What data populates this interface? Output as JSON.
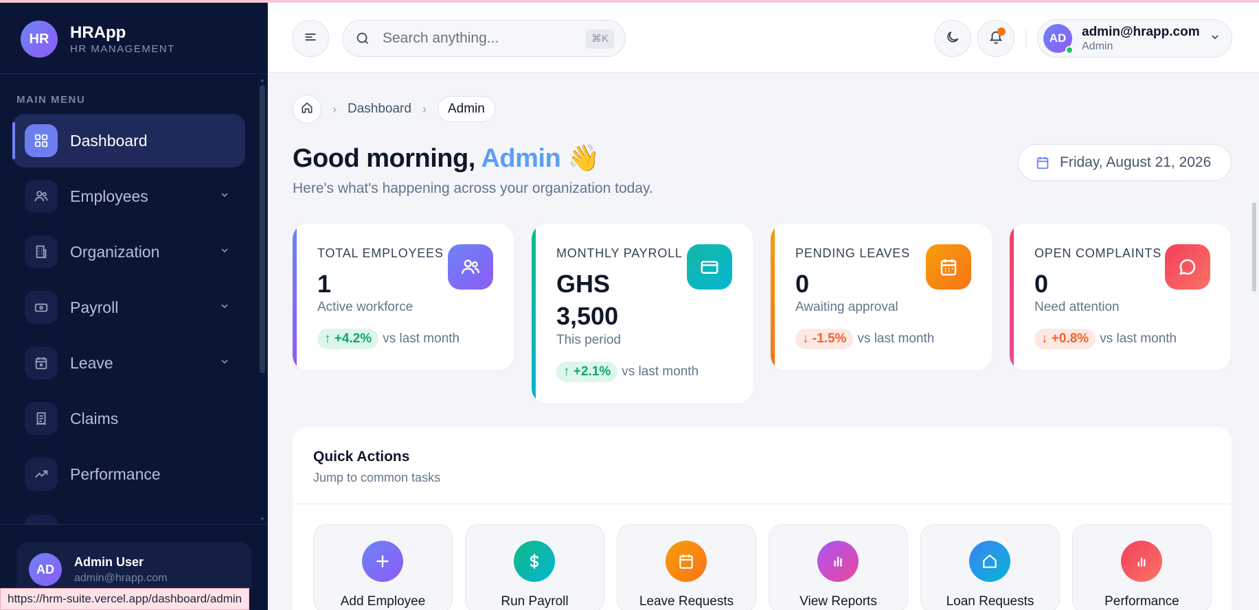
{
  "brand": {
    "logo_initials": "HR",
    "name": "HRApp",
    "subtitle": "HR MANAGEMENT"
  },
  "sidebar": {
    "menu_label": "MAIN MENU",
    "items": [
      {
        "label": "Dashboard",
        "icon": "grid-icon",
        "active": true
      },
      {
        "label": "Employees",
        "icon": "users-icon",
        "has_children": true
      },
      {
        "label": "Organization",
        "icon": "building-icon",
        "has_children": true
      },
      {
        "label": "Payroll",
        "icon": "wallet-icon",
        "has_children": true
      },
      {
        "label": "Leave",
        "icon": "calendar-icon",
        "has_children": true
      },
      {
        "label": "Claims",
        "icon": "receipt-icon"
      },
      {
        "label": "Performance",
        "icon": "trending-up-icon"
      }
    ],
    "user": {
      "initials": "AD",
      "name": "Admin User",
      "email": "admin@hrapp.com"
    }
  },
  "header": {
    "search_placeholder": "Search anything...",
    "shortcut": "⌘K",
    "profile": {
      "initials": "AD",
      "email": "admin@hrapp.com",
      "role": "Admin"
    }
  },
  "breadcrumb": {
    "items": [
      "Dashboard"
    ],
    "current": "Admin"
  },
  "greeting": {
    "prefix": "Good morning, ",
    "name": "Admin",
    "emoji": "👋",
    "subtitle": "Here's what's happening across your organization today."
  },
  "date": "Friday, August 21, 2026",
  "stats": [
    {
      "label": "TOTAL EMPLOYEES",
      "value": "1",
      "caption": "Active workforce",
      "trend": "+4.2%",
      "direction": "up",
      "note": "vs last month",
      "color": "#7c6cf0"
    },
    {
      "label": "MONTHLY PAYROLL",
      "value": "GHS 3,500",
      "caption": "This period",
      "trend": "+2.1%",
      "direction": "up",
      "note": "vs last month",
      "color": "#14b8a6"
    },
    {
      "label": "PENDING LEAVES",
      "value": "0",
      "caption": "Awaiting approval",
      "trend": "-1.5%",
      "direction": "down",
      "note": "vs last month",
      "color": "#f59e0b"
    },
    {
      "label": "OPEN COMPLAINTS",
      "value": "0",
      "caption": "Need attention",
      "trend": "+0.8%",
      "direction": "down",
      "note": "vs last month",
      "color": "#f43f5e"
    }
  ],
  "quick_actions": {
    "title": "Quick Actions",
    "subtitle": "Jump to common tasks",
    "items": [
      {
        "label": "Add Employee",
        "icon": "plus-icon"
      },
      {
        "label": "Run Payroll",
        "icon": "dollar-icon"
      },
      {
        "label": "Leave Requests",
        "icon": "calendar-icon"
      },
      {
        "label": "View Reports",
        "icon": "bar-chart-icon"
      },
      {
        "label": "Loan Requests",
        "icon": "home-icon"
      },
      {
        "label": "Performance",
        "icon": "bar-chart-icon"
      }
    ]
  },
  "status_bar_url": "https://hrm-suite.vercel.app/dashboard/admin"
}
